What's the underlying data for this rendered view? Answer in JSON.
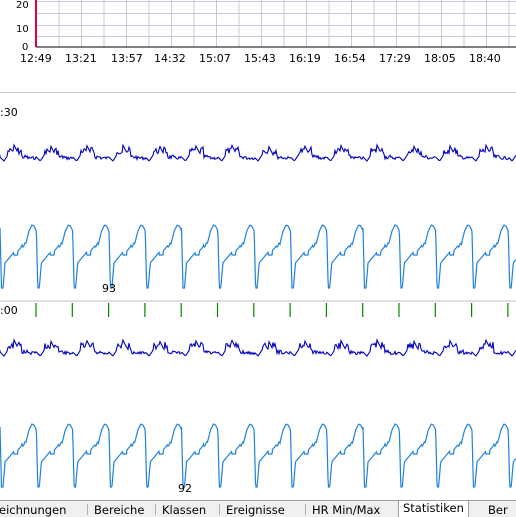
{
  "trend": {
    "y_ticks": [
      "20",
      "10",
      "0"
    ],
    "x_ticks": [
      "12:49",
      "13:21",
      "13:57",
      "14:32",
      "15:07",
      "15:43",
      "16:19",
      "16:54",
      "17:29",
      "18:05",
      "18:40"
    ],
    "grid_color": "#c8c8e0",
    "cursor_color": "#e0004a"
  },
  "strip1": {
    "time": ":30",
    "beat_label": "93"
  },
  "strip2": {
    "time": ":00",
    "beat_label": "92",
    "marker_color": "#008800"
  },
  "colors": {
    "lead1": "#0000c0",
    "lead2": "#1e82dc"
  },
  "tabs": [
    {
      "label": "eichnungen"
    },
    {
      "label": "Bereiche"
    },
    {
      "label": "Klassen"
    },
    {
      "label": "Ereignisse"
    },
    {
      "label": "HR Min/Max"
    },
    {
      "label": "Statistiken",
      "active": true
    },
    {
      "label": "Ber"
    }
  ]
}
